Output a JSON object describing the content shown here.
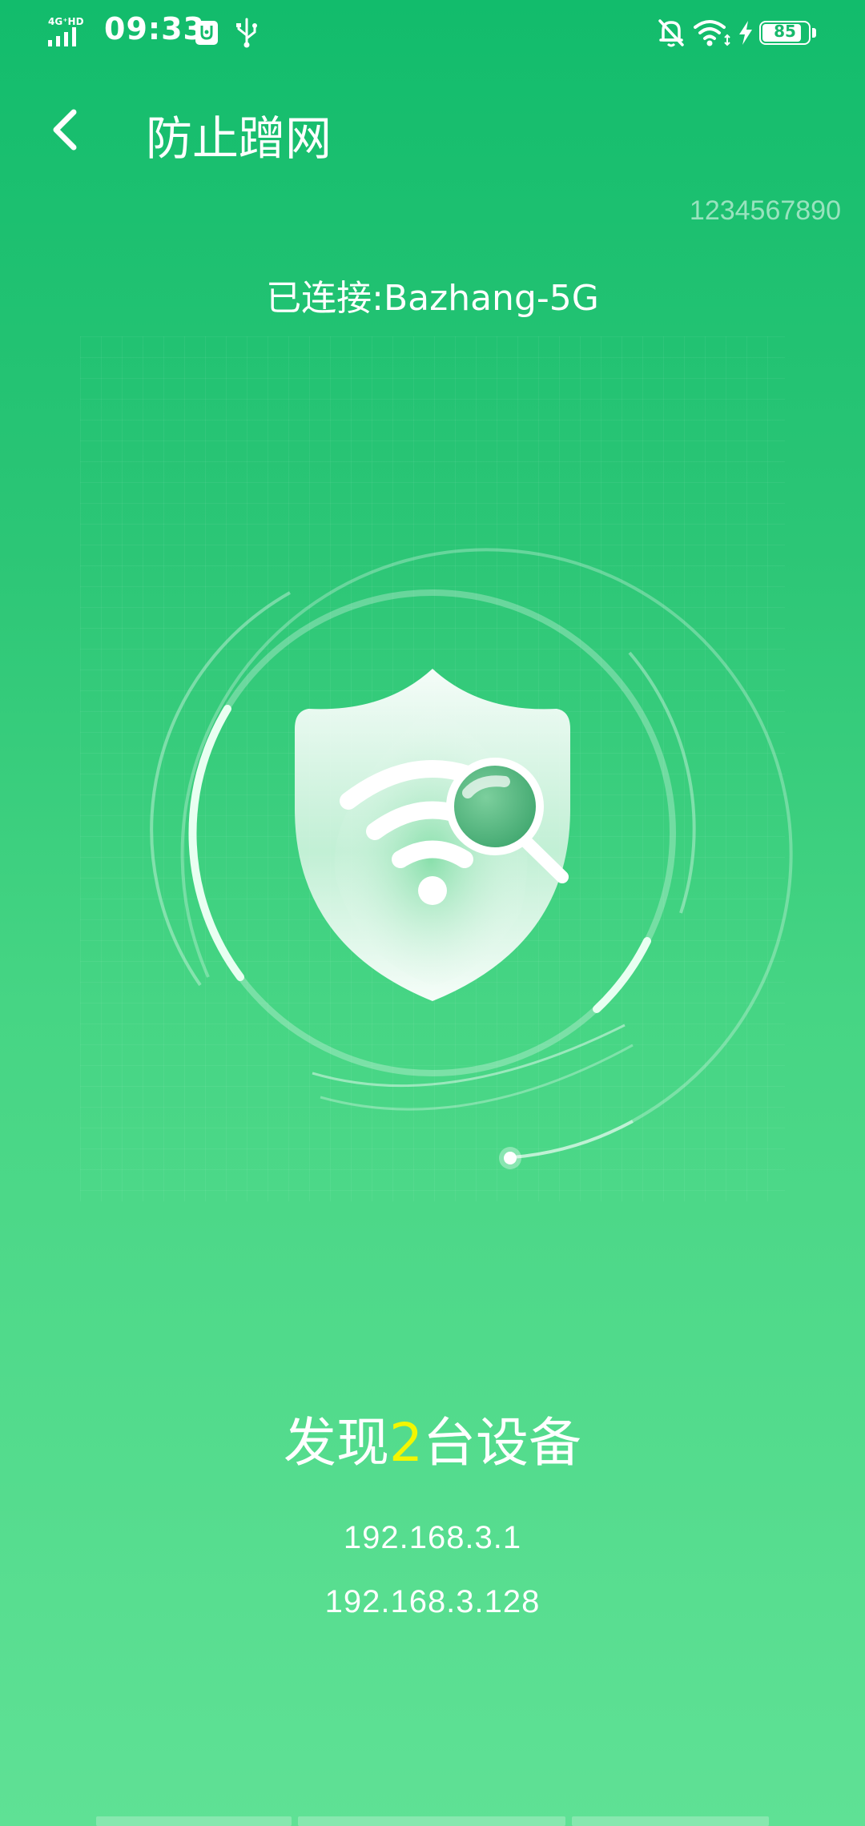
{
  "status_bar": {
    "network": "4G⁺HD",
    "time": "09:33",
    "battery": "85",
    "icons": [
      "signal-icon",
      "usb-debug-icon",
      "usb-icon",
      "bell-off-icon",
      "wifi-icon",
      "charging-icon",
      "battery-icon"
    ]
  },
  "header": {
    "title": "防止蹭网",
    "back_icon": "chevron-left-icon"
  },
  "device_id": "1234567890",
  "connection": {
    "label": "已连接:Bazhang-5G"
  },
  "illustration": {
    "icon": "shield-wifi-search-icon"
  },
  "result": {
    "prefix": "发现",
    "count": "2",
    "suffix": "台设备",
    "count_color": "#f3f600",
    "devices": [
      {
        "ip": "192.168.3.1"
      },
      {
        "ip": "192.168.3.128"
      }
    ]
  },
  "colors": {
    "background_top": "#12bc6c",
    "background_bottom": "#5fe195"
  }
}
